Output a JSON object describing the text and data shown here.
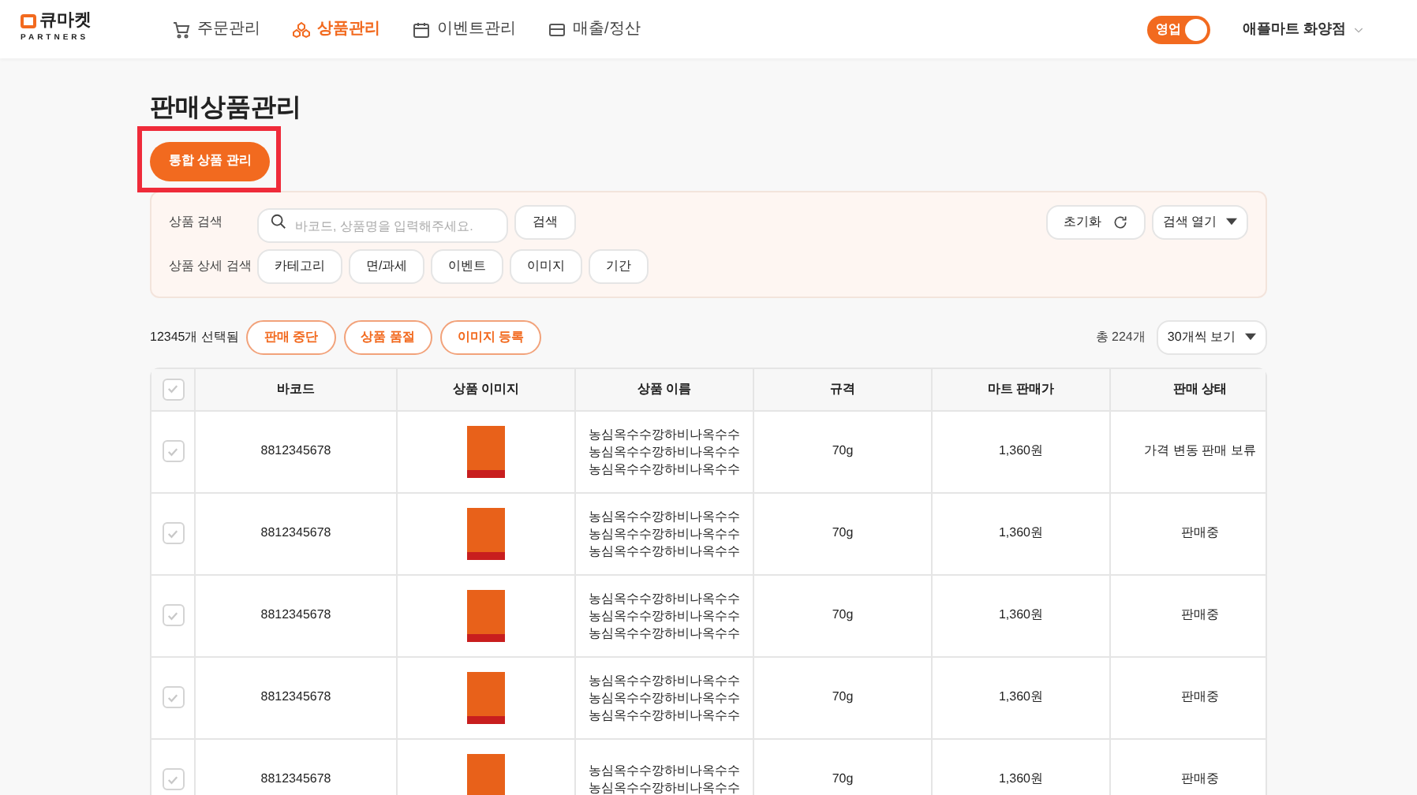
{
  "header": {
    "logo": {
      "name": "큐마켓",
      "sub": "PARTNERS"
    },
    "nav": [
      {
        "label": "주문관리",
        "kind": "cart",
        "selected": false
      },
      {
        "label": "상품관리",
        "kind": "box",
        "selected": true
      },
      {
        "label": "이벤트관리",
        "kind": "calendar",
        "selected": false
      },
      {
        "label": "매출/정산",
        "kind": "wallet",
        "selected": false
      }
    ],
    "open_toggle": {
      "label": "영업",
      "on": true
    },
    "store": "애플마트 화양점"
  },
  "page_title": "판매상품관리",
  "integrated_button": {
    "label": "통합 상품 관리",
    "highlighted": true
  },
  "search_panel": {
    "search_label": "상품 검색",
    "placeholder": "바코드, 상품명을 입력해주세요.",
    "search_button": "검색",
    "reset_button": "초기화",
    "expand_button": "검색 열기",
    "detail_label": "상품 상세 검색",
    "filters": [
      "카테고리",
      "면/과세",
      "이벤트",
      "이미지",
      "기간"
    ]
  },
  "actions": {
    "selected_count": "12345개 선택됨",
    "buttons": [
      "판매 중단",
      "상품 품절",
      "이미지 등록"
    ],
    "total": "총 224개",
    "page_size": "30개씩 보기"
  },
  "table": {
    "header_checked": false,
    "columns": [
      "바코드",
      "상품 이미지",
      "상품 이름",
      "규격",
      "마트 판매가",
      "판매 상태"
    ],
    "rows": [
      {
        "checked": false,
        "barcode": "8812345678",
        "name_lines": [
          "농심옥수수깡하비나옥수수",
          "농심옥수수깡하비나옥수수",
          "농심옥수수깡하비나옥수수"
        ],
        "size": "70g",
        "price": "1,360원",
        "status": "가격 변동 판매 보류"
      },
      {
        "checked": false,
        "barcode": "8812345678",
        "name_lines": [
          "농심옥수수깡하비나옥수수",
          "농심옥수수깡하비나옥수수",
          "농심옥수수깡하비나옥수수"
        ],
        "size": "70g",
        "price": "1,360원",
        "status": "판매중"
      },
      {
        "checked": false,
        "barcode": "8812345678",
        "name_lines": [
          "농심옥수수깡하비나옥수수",
          "농심옥수수깡하비나옥수수",
          "농심옥수수깡하비나옥수수"
        ],
        "size": "70g",
        "price": "1,360원",
        "status": "판매중"
      },
      {
        "checked": false,
        "barcode": "8812345678",
        "name_lines": [
          "농심옥수수깡하비나옥수수",
          "농심옥수수깡하비나옥수수",
          "농심옥수수깡하비나옥수수"
        ],
        "size": "70g",
        "price": "1,360원",
        "status": "판매중"
      },
      {
        "checked": false,
        "barcode": "8812345678",
        "name_lines": [
          "농심옥수수깡하비나옥수수",
          "농심옥수수깡하비나옥수수"
        ],
        "size": "70g",
        "price": "1,360원",
        "status": "판매중"
      }
    ]
  }
}
